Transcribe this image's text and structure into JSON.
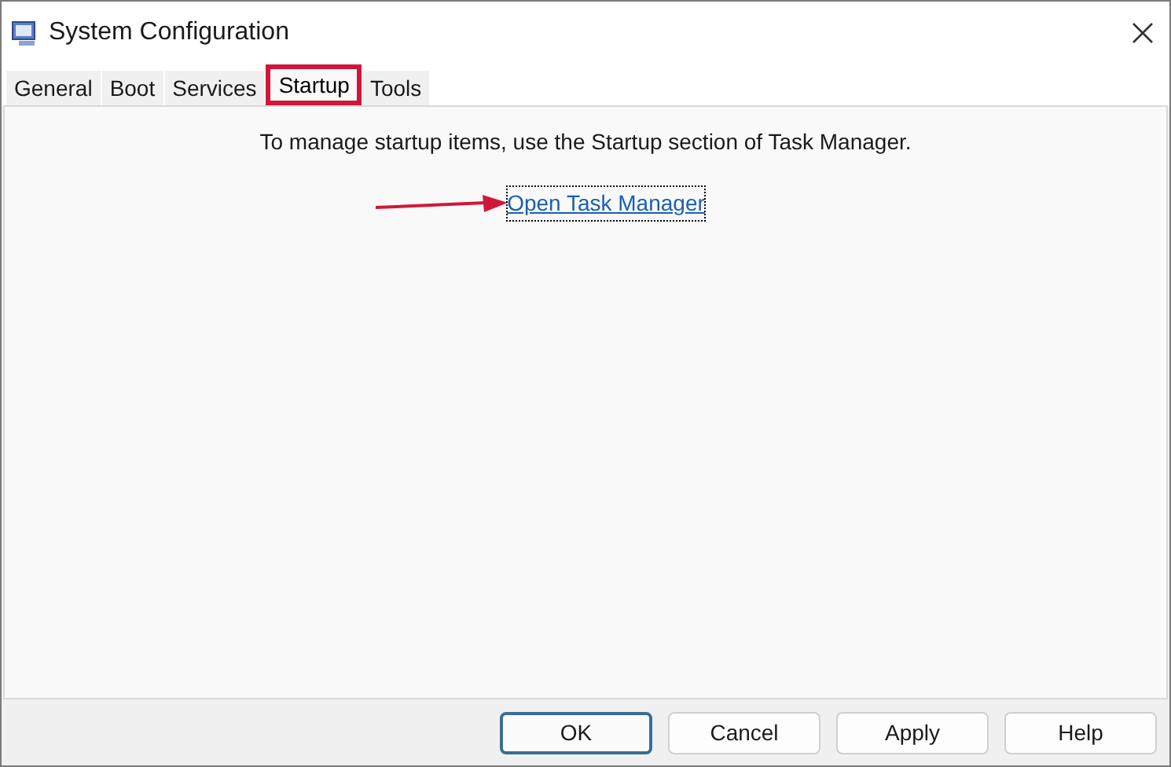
{
  "window": {
    "title": "System Configuration"
  },
  "tabs": [
    {
      "label": "General",
      "selected": false,
      "highlighted": false
    },
    {
      "label": "Boot",
      "selected": false,
      "highlighted": false
    },
    {
      "label": "Services",
      "selected": false,
      "highlighted": false
    },
    {
      "label": "Startup",
      "selected": true,
      "highlighted": true
    },
    {
      "label": "Tools",
      "selected": false,
      "highlighted": false
    }
  ],
  "content": {
    "message": "To manage startup items, use the Startup section of Task Manager.",
    "link": "Open Task Manager"
  },
  "buttons": [
    {
      "label": "OK",
      "default": true
    },
    {
      "label": "Cancel",
      "default": false
    },
    {
      "label": "Apply",
      "default": false
    },
    {
      "label": "Help",
      "default": false
    }
  ]
}
